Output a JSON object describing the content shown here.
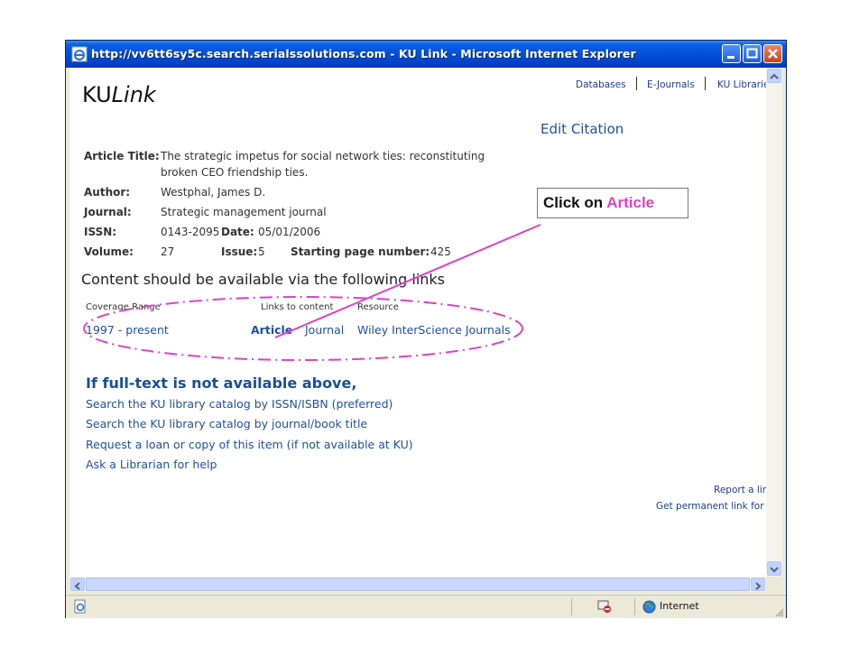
{
  "window": {
    "title": "http://vv6tt6sy5c.search.serialssolutions.com - KU Link - Microsoft Internet Explorer"
  },
  "logo": {
    "prefix": "KU",
    "suffix": "Link"
  },
  "top_nav": [
    "Databases",
    "E-Journals",
    "KU Librarie"
  ],
  "edit_citation": "Edit Citation",
  "citation": {
    "article_title_label": "Article Title:",
    "article_title_line1": "The strategic impetus for social network ties: reconstituting",
    "article_title_line2": "broken CEO friendship ties.",
    "author_label": "Author:",
    "author": "Westphal, James D.",
    "journal_label": "Journal:",
    "journal": "Strategic management journal",
    "issn_label": "ISSN:",
    "issn": "0143-2095",
    "date_label": "Date:",
    "date": "05/01/2006",
    "volume_label": "Volume:",
    "volume": "27",
    "issue_label": "Issue:",
    "issue": "5",
    "start_page_label": "Starting page number:",
    "start_page": "425"
  },
  "availability": {
    "heading": "Content should be available via the following links",
    "columns": [
      "Coverage Range",
      "Links to content",
      "Resource"
    ],
    "row": {
      "coverage": "1997 - present",
      "article_link": "Article",
      "journal_link": "Journal",
      "resource": "Wiley InterScience Journals"
    }
  },
  "fulltext": {
    "heading": "If full-text is not available above,",
    "links": [
      "Search the KU library catalog by ISSN/ISBN (preferred)",
      "Search the KU library catalog by journal/book title",
      "Request a loan or copy of this item (if not available at KU)",
      "Ask a Librarian for help"
    ]
  },
  "footer_links": {
    "report": "Report a lin",
    "permanent": "Get permanent link for th"
  },
  "callout": {
    "prefix": "Click on ",
    "accent": "Article",
    "accent_color": "#e040c8"
  },
  "status_bar": {
    "zone": "Internet"
  },
  "colors": {
    "titlebar": "#0450d8",
    "link": "#1f4f9f",
    "annotation": "#e040c8"
  }
}
